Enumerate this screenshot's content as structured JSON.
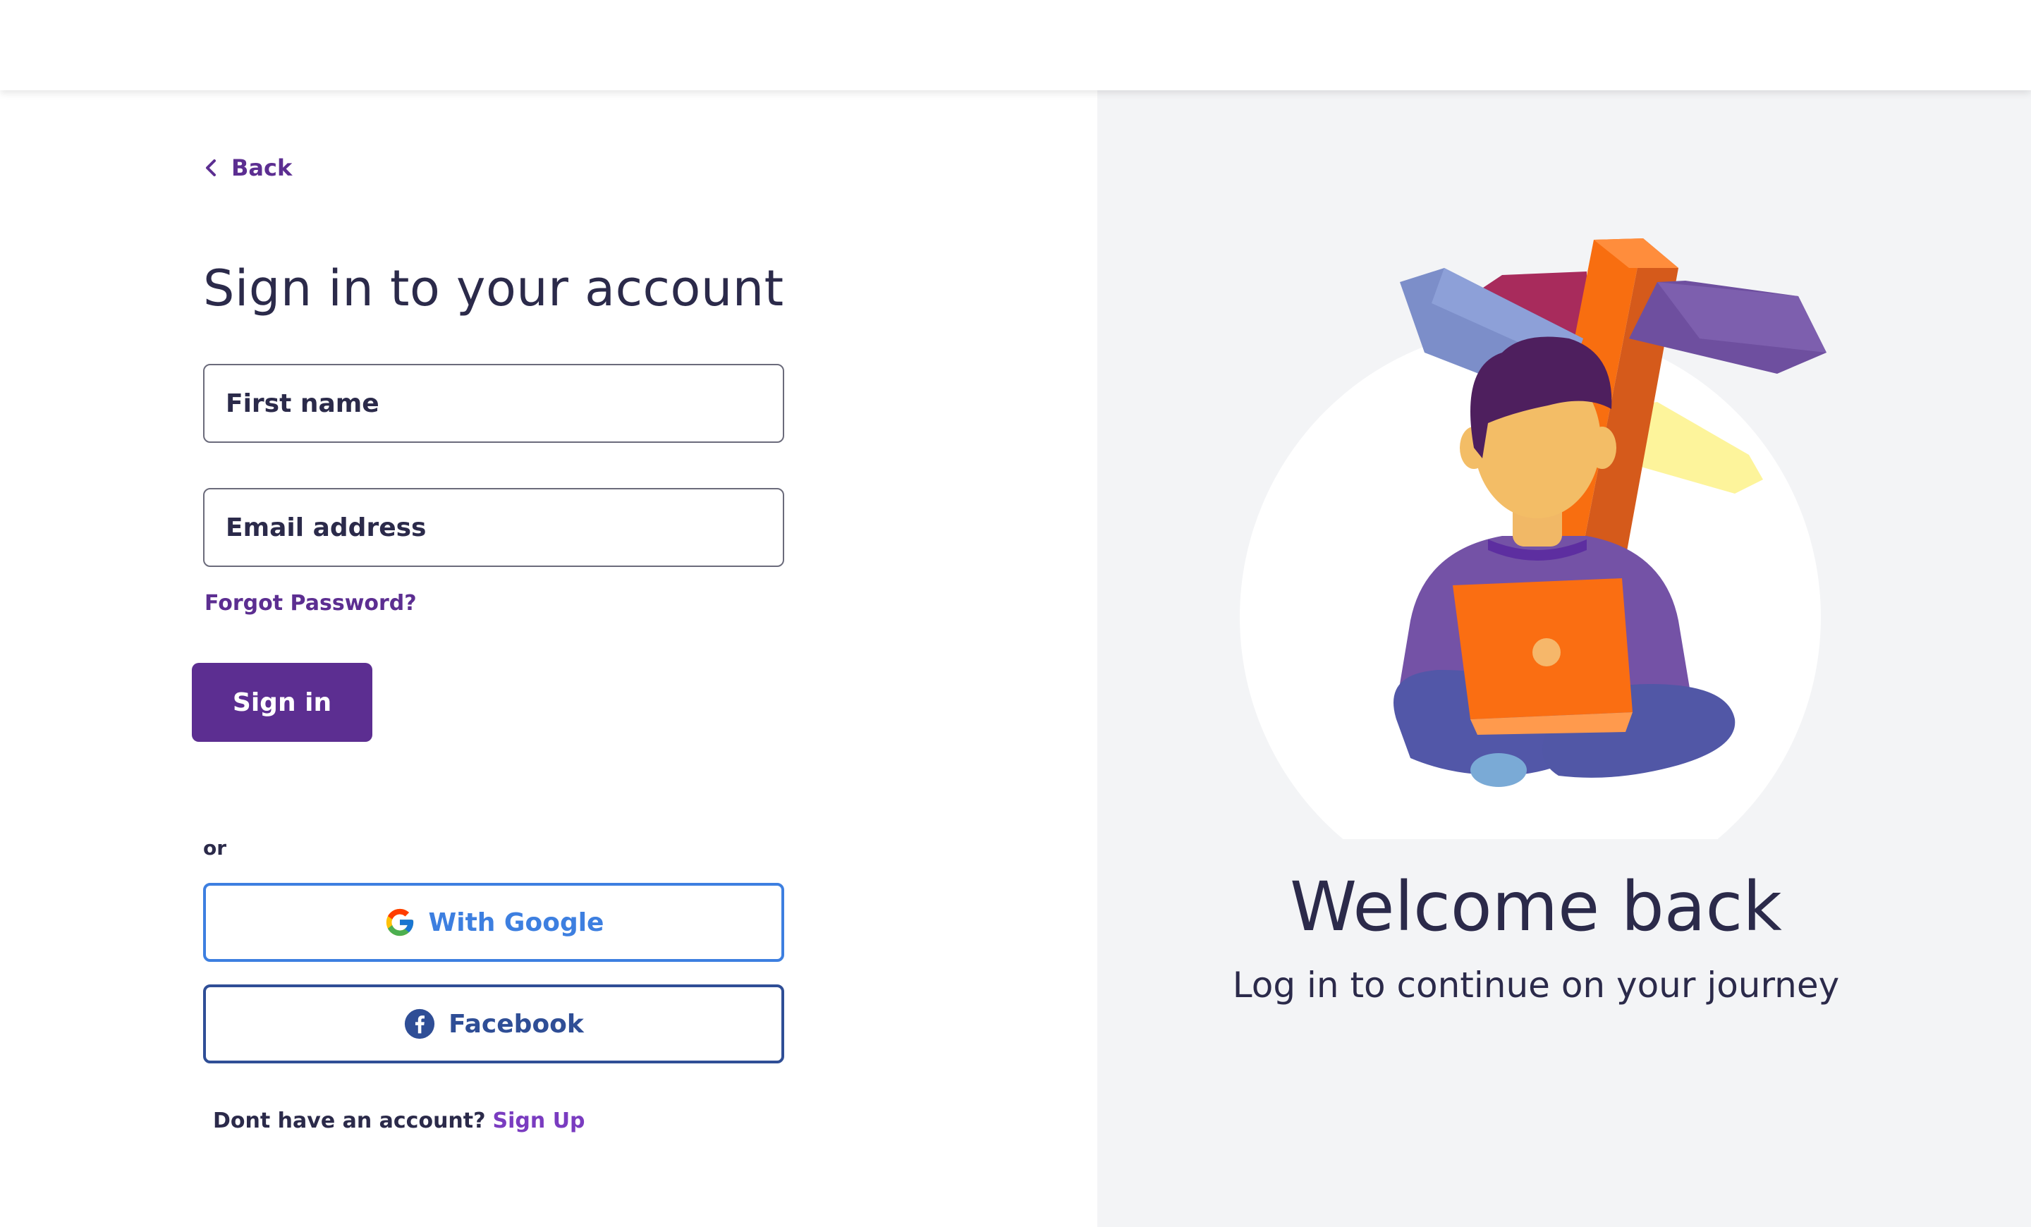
{
  "nav": {
    "back_label": "Back"
  },
  "form": {
    "title": "Sign in to your account",
    "first_name_placeholder": "First name",
    "email_placeholder": "Email address",
    "forgot_password": "Forgot Password?",
    "signin_label": "Sign in",
    "or_label": "or"
  },
  "social": {
    "google_label": "With Google",
    "facebook_label": "Facebook"
  },
  "signup": {
    "prompt": "Dont have an account?",
    "link": "Sign Up"
  },
  "hero": {
    "title": "Welcome back",
    "subtitle": "Log in to continue on your journey"
  },
  "colors": {
    "brand_purple": "#5c2e91",
    "google_blue": "#3d7fe0",
    "facebook_blue": "#2f4e96",
    "panel_gray": "#f3f4f6"
  },
  "icons": [
    "chevron-left-icon",
    "google-icon",
    "facebook-icon"
  ]
}
